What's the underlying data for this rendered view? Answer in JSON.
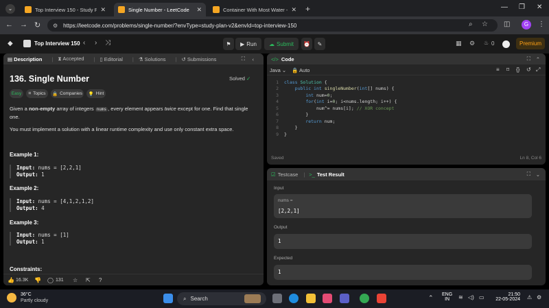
{
  "browser": {
    "tabs": [
      {
        "title": "Top Interview 150 - Study Plan",
        "close": "✕"
      },
      {
        "title": "Single Number - LeetCode",
        "close": "✕"
      },
      {
        "title": "Container With Most Water - Le",
        "close": "✕"
      }
    ],
    "new_tab": "+",
    "url": "https://leetcode.com/problems/single-number/?envType=study-plan-v2&envId=top-interview-150",
    "profile_initial": "G"
  },
  "lc_header": {
    "list_name": "Top Interview 150",
    "run_label": "Run",
    "submit_label": "Submit",
    "streak_count": "0",
    "premium_label": "Premium"
  },
  "left_tabs": [
    "Description",
    "Accepted",
    "Editorial",
    "Solutions",
    "Submissions"
  ],
  "problem": {
    "title": "136. Single Number",
    "status": "Solved",
    "chips": [
      "Easy",
      "Topics",
      "Companies",
      "Hint"
    ],
    "statement_pre": "Given a",
    "statement_bold": "non-empty",
    "statement_mid": "array of integers",
    "statement_code": "nums",
    "statement_mid2": ", every element appears",
    "statement_em": "twice",
    "statement_post": "except for one. Find that single one.",
    "requirement": "You must implement a solution with a linear runtime complexity and use only constant extra space.",
    "examples": [
      {
        "title": "Example 1:",
        "input": "nums = [2,2,1]",
        "output": "1"
      },
      {
        "title": "Example 2:",
        "input": "nums = [4,1,2,1,2]",
        "output": "4"
      },
      {
        "title": "Example 3:",
        "input": "nums = [1]",
        "output": "1"
      }
    ],
    "input_label": "Input:",
    "output_label": "Output:",
    "constraints_title": "Constraints:"
  },
  "left_footer": {
    "likes": "16.3K",
    "comments": "131"
  },
  "editor": {
    "title": "Code",
    "language": "Java",
    "mode": "Auto",
    "status_left": "Saved",
    "status_right": "Ln 8, Col 6",
    "line_numbers": [
      "1",
      "2",
      "3",
      "4",
      "5",
      "6",
      "7",
      "8",
      "9"
    ]
  },
  "test": {
    "tab_testcase": "Testcase",
    "tab_result": "Test Result",
    "input_label": "Input",
    "var_label": "nums =",
    "input_value": "[2,2,1]",
    "output_label": "Output",
    "output_value": "1",
    "expected_label": "Expected",
    "expected_value": "1"
  },
  "taskbar": {
    "temperature": "36°C",
    "weather": "Partly cloudy",
    "search_label": "Search",
    "lang_top": "ENG",
    "lang_bottom": "IN",
    "time": "21:50",
    "date": "22-05-2024"
  },
  "colors": {
    "accent_orange": "#ffa116",
    "success_green": "#2cbb5d",
    "panel_bg": "#262626"
  }
}
